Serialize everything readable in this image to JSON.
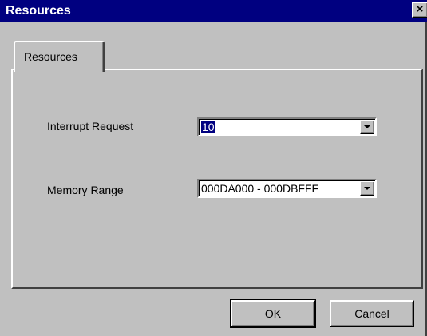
{
  "window": {
    "title": "Resources",
    "close_label": "×"
  },
  "tab": {
    "label": "Resources"
  },
  "fields": {
    "irq": {
      "label": "Interrupt Request",
      "value": "10"
    },
    "memory": {
      "label": "Memory Range",
      "value": "000DA000 - 000DBFFF"
    }
  },
  "buttons": {
    "ok": "OK",
    "cancel": "Cancel"
  },
  "icons": {
    "close": "close-icon",
    "dropdown": "chevron-down-icon"
  },
  "colors": {
    "titlebar": "#000080",
    "face": "#c0c0c0",
    "selection": "#000080"
  }
}
